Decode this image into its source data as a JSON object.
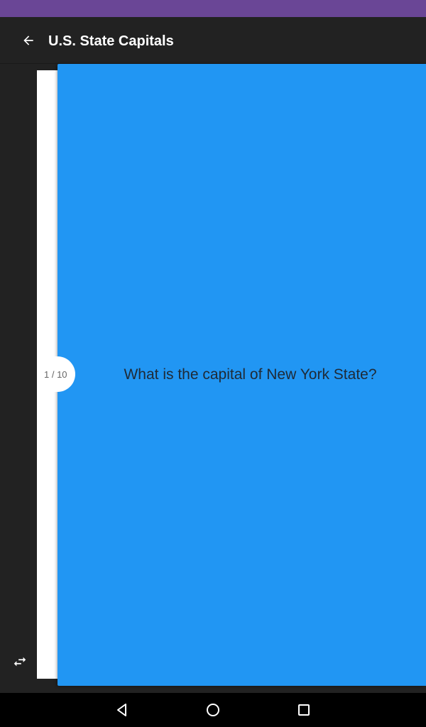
{
  "status_bar": {
    "color": "#6a4696"
  },
  "app_bar": {
    "title": "U.S. State Capitals",
    "back_icon": "arrow-back-icon"
  },
  "card": {
    "question": "What is the capital of New York State?",
    "color": "#2196f3"
  },
  "counter": {
    "text": "1 / 10"
  },
  "footer": {
    "swap_icon": "swap-horizontal-icon"
  },
  "nav_bar": {
    "back_icon": "nav-back-icon",
    "home_icon": "nav-home-icon",
    "recents_icon": "nav-recents-icon"
  }
}
